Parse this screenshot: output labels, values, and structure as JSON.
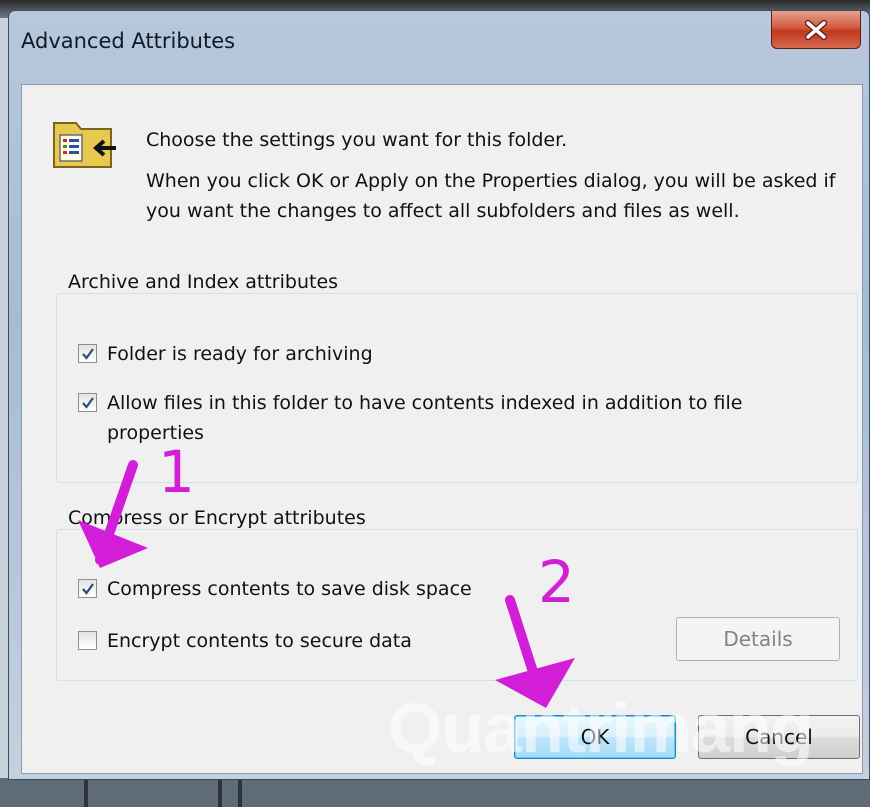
{
  "window": {
    "title": "Advanced Attributes"
  },
  "intro": {
    "line1": "Choose the settings you want for this folder.",
    "line2": "When you click OK or Apply on the Properties dialog, you will be asked if you want the changes to affect all subfolders and files as well."
  },
  "archive_group": {
    "title": "Archive and Index attributes",
    "items": [
      {
        "label": "Folder is ready for archiving",
        "checked": true
      },
      {
        "label": "Allow files in this folder to have contents indexed in addition to file properties",
        "checked": true
      }
    ]
  },
  "compress_group": {
    "title": "Compress or Encrypt attributes",
    "items": [
      {
        "label": "Compress contents to save disk space",
        "checked": true
      },
      {
        "label": "Encrypt contents to secure data",
        "checked": false
      }
    ],
    "details_label": "Details"
  },
  "buttons": {
    "ok": "OK",
    "cancel": "Cancel"
  },
  "annotations": {
    "step1": "1",
    "step2": "2",
    "color": "#d21fd7"
  },
  "watermark": "Quantrimang"
}
